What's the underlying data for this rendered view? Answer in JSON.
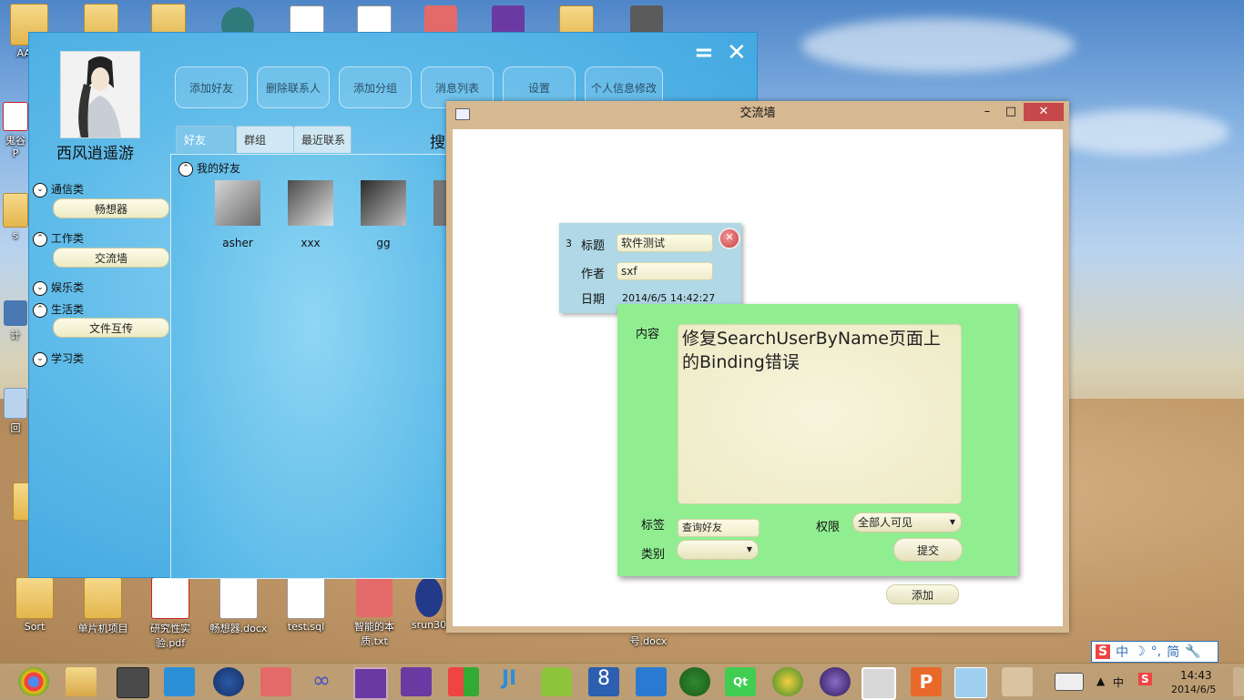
{
  "desktop": {
    "top_icons": [
      "AAA-"
    ],
    "left_labels": [
      "鬼谷",
      "P",
      "s",
      "计",
      "回"
    ],
    "bottom_icons": [
      "Sort",
      "单片机项目",
      "研究性实验.pdf",
      "畅想器.docx",
      "test.sql",
      "智能的本质.txt",
      "srun30"
    ],
    "extra_label": "号.docx"
  },
  "main_window": {
    "user_name": "西风逍遥游",
    "controls": {
      "minimize": "=",
      "close": "✕"
    },
    "toolbar": [
      "添加好友",
      "删除联系人",
      "添加分组",
      "消息列表",
      "设置",
      "个人信息修改"
    ],
    "tabs": [
      "好友",
      "群组",
      "最近联系"
    ],
    "search_label": "搜",
    "friends_group": "我的好友",
    "friends": [
      "asher",
      "xxx",
      "gg"
    ],
    "categories": {
      "comm": {
        "label": "通信类",
        "items": [
          "畅想器"
        ]
      },
      "work": {
        "label": "工作类",
        "items": [
          "交流墙"
        ]
      },
      "ent": {
        "label": "娱乐类"
      },
      "life": {
        "label": "生活类",
        "items": [
          "文件互传"
        ]
      },
      "study": {
        "label": "学习类"
      }
    }
  },
  "wall_window": {
    "title": "交流墙",
    "controls": {
      "minimize": "–",
      "maximize": "□",
      "close": "✕"
    },
    "card": {
      "number": "3",
      "title_label": "标题",
      "title_value": "软件测试",
      "author_label": "作者",
      "author_value": "sxf",
      "date_label": "日期",
      "date_value": "2014/6/5 14:42:27"
    },
    "editor": {
      "content_label": "内容",
      "content_value": "修复SearchUserByName页面上的Binding错误",
      "tag_label": "标签",
      "tag_value": "查询好友",
      "permission_label": "权限",
      "permission_value": "全部人可见",
      "category_label": "类别",
      "category_value": "",
      "submit_label": "提交"
    },
    "add_label": "添加"
  },
  "taskbar": {
    "tray": {
      "ime": "中",
      "time": "14:43",
      "date": "2014/6/5"
    },
    "ime_bar": [
      "中",
      "简"
    ]
  },
  "colors": {
    "main_window": "#5fbbe9",
    "wall_card": "#b0d8e6",
    "editor": "#90ee90",
    "wall_frame": "#d6b891",
    "close": "#c7484a"
  }
}
